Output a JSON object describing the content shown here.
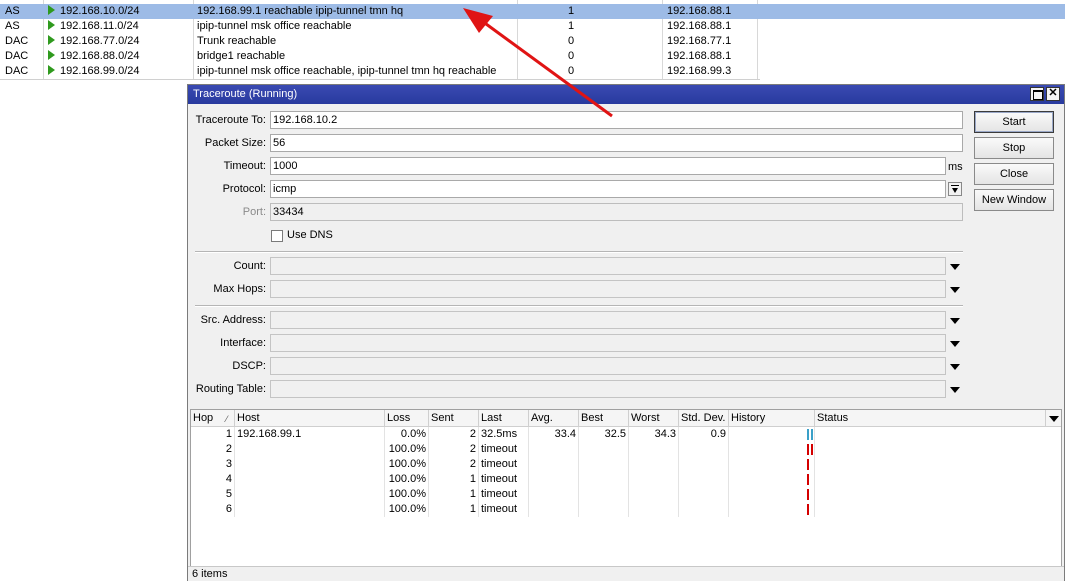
{
  "routes": [
    {
      "flag": "AS",
      "dst": "192.168.10.0/24",
      "gateway": "192.168.99.1 reachable ipip-tunnel tmn hq",
      "distance": "1",
      "pref_src": "192.168.88.1",
      "selected": true
    },
    {
      "flag": "AS",
      "dst": "192.168.11.0/24",
      "gateway": "ipip-tunnel msk office reachable",
      "distance": "1",
      "pref_src": "192.168.88.1",
      "selected": false
    },
    {
      "flag": "DAC",
      "dst": "192.168.77.0/24",
      "gateway": "Trunk reachable",
      "distance": "0",
      "pref_src": "192.168.77.1",
      "selected": false
    },
    {
      "flag": "DAC",
      "dst": "192.168.88.0/24",
      "gateway": "bridge1 reachable",
      "distance": "0",
      "pref_src": "192.168.88.1",
      "selected": false
    },
    {
      "flag": "DAC",
      "dst": "192.168.99.0/24",
      "gateway": "ipip-tunnel msk office reachable, ipip-tunnel tmn hq reachable",
      "distance": "0",
      "pref_src": "192.168.99.3",
      "selected": false
    }
  ],
  "traceroute": {
    "title": "Traceroute (Running)",
    "form": {
      "traceroute_to_label": "Traceroute To:",
      "traceroute_to_value": "192.168.10.2",
      "packet_size_label": "Packet Size:",
      "packet_size_value": "56",
      "timeout_label": "Timeout:",
      "timeout_value": "1000",
      "timeout_unit": "ms",
      "protocol_label": "Protocol:",
      "protocol_value": "icmp",
      "port_label": "Port:",
      "port_value": "33434",
      "use_dns_label": "Use DNS",
      "count_label": "Count:",
      "max_hops_label": "Max Hops:",
      "src_address_label": "Src. Address:",
      "interface_label": "Interface:",
      "dscp_label": "DSCP:",
      "routing_table_label": "Routing Table:"
    },
    "buttons": {
      "start": "Start",
      "stop": "Stop",
      "close": "Close",
      "new_window": "New Window"
    },
    "columns": {
      "hop": "Hop",
      "host": "Host",
      "loss": "Loss",
      "sent": "Sent",
      "last": "Last",
      "avg": "Avg.",
      "best": "Best",
      "worst": "Worst",
      "std_dev": "Std. Dev.",
      "history": "History",
      "status": "Status"
    },
    "hops": [
      {
        "hop": "1",
        "host": "192.168.99.1",
        "loss": "0.0%",
        "sent": "2",
        "last": "32.5ms",
        "avg": "33.4",
        "best": "32.5",
        "worst": "34.3",
        "std_dev": "0.9",
        "history": [
          "ok",
          "ok"
        ]
      },
      {
        "hop": "2",
        "host": "",
        "loss": "100.0%",
        "sent": "2",
        "last": "timeout",
        "avg": "",
        "best": "",
        "worst": "",
        "std_dev": "",
        "history": [
          "lost",
          "lost"
        ]
      },
      {
        "hop": "3",
        "host": "",
        "loss": "100.0%",
        "sent": "2",
        "last": "timeout",
        "avg": "",
        "best": "",
        "worst": "",
        "std_dev": "",
        "history": [
          "lost"
        ]
      },
      {
        "hop": "4",
        "host": "",
        "loss": "100.0%",
        "sent": "1",
        "last": "timeout",
        "avg": "",
        "best": "",
        "worst": "",
        "std_dev": "",
        "history": [
          "lost"
        ]
      },
      {
        "hop": "5",
        "host": "",
        "loss": "100.0%",
        "sent": "1",
        "last": "timeout",
        "avg": "",
        "best": "",
        "worst": "",
        "std_dev": "",
        "history": [
          "lost"
        ]
      },
      {
        "hop": "6",
        "host": "",
        "loss": "100.0%",
        "sent": "1",
        "last": "timeout",
        "avg": "",
        "best": "",
        "worst": "",
        "std_dev": "",
        "history": [
          "lost"
        ]
      }
    ],
    "status_bar": "6 items"
  },
  "colors": {
    "selected_row": "#9dbbe6",
    "title_bar": "#283a9e",
    "history_ok": "#3aa0c8",
    "history_lost": "#d40000",
    "annotation_arrow": "#e01414"
  }
}
